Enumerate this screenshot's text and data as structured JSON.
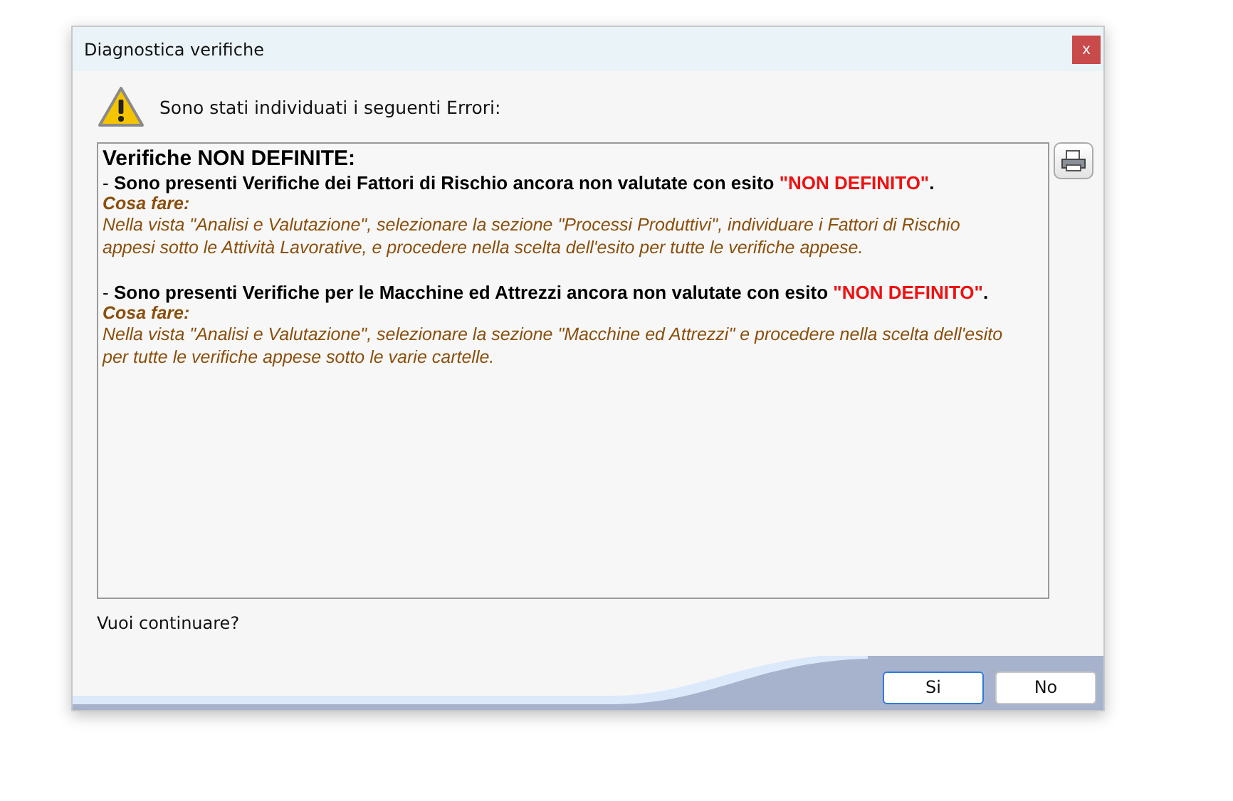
{
  "window": {
    "title": "Diagnostica verifiche",
    "close": "x"
  },
  "message": "Sono stati individuati i seguenti Errori:",
  "report": {
    "heading": "Verifiche NON DEFINITE:",
    "items": [
      {
        "statement": "- **Sono presenti Verifiche dei Fattori di Rischio ancora non valutate con esito** ",
        "highlight": "\"NON DEFINITO\"",
        "end": ".",
        "action_label": "Cosa fare:",
        "action": "Nella vista \"Analisi e Valutazione\", selezionare la sezione \"Processi Produttivi\", individuare i Fattori di Rischio appesi sotto le Attività Lavorative, e procedere nella scelta dell'esito per tutte le verifiche appese."
      },
      {
        "statement": "- **Sono presenti Verifiche per le Macchine ed Attrezzi ancora non valutate con esito** ",
        "highlight": "\"NON DEFINITO\"",
        "end": ".",
        "action_label": "Cosa fare:",
        "action": "Nella vista \"Analisi e Valutazione\", selezionare la sezione \"Macchine ed Attrezzi\" e procedere nella scelta dell'esito per tutte le verifiche appese sotto le varie cartelle."
      }
    ]
  },
  "question": "Vuoi continuare?",
  "buttons": [
    {
      "label": "Si",
      "selected": true
    },
    {
      "label": "No",
      "selected": false
    }
  ]
}
